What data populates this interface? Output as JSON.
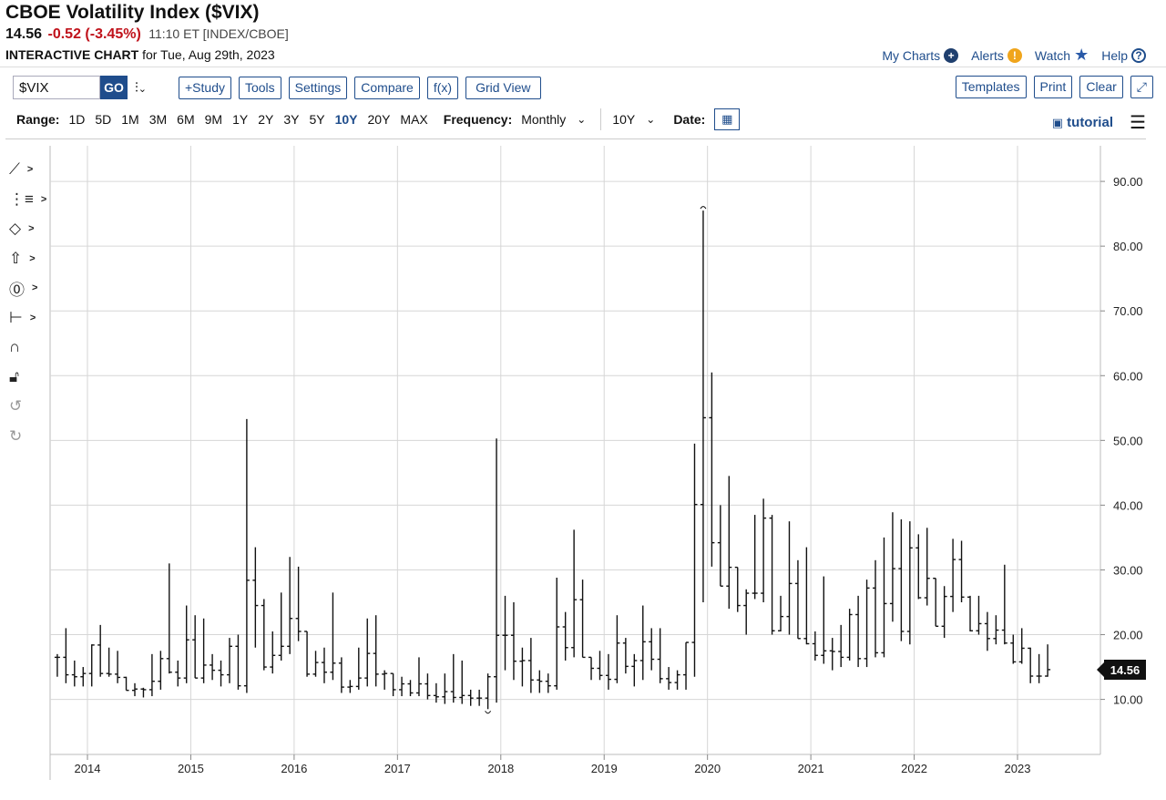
{
  "header": {
    "title": "CBOE Volatility Index ($VIX)",
    "last": "14.56",
    "change": "-0.52 (-3.45%)",
    "time": "11:10 ET [INDEX/CBOE]",
    "sub_bold": "INTERACTIVE CHART",
    "sub_rest": "for Tue, Aug 29th, 2023"
  },
  "toplinks": {
    "my_charts": "My Charts",
    "alerts": "Alerts",
    "watch": "Watch",
    "help": "Help"
  },
  "toolbar": {
    "symbol": "$VIX",
    "go": "GO",
    "study": "+Study",
    "tools": "Tools",
    "settings": "Settings",
    "compare": "Compare",
    "fx": "f(x)",
    "grid_view": "Grid View",
    "templates": "Templates",
    "print": "Print",
    "clear": "Clear"
  },
  "rangebar": {
    "range_label": "Range:",
    "ranges": [
      "1D",
      "5D",
      "1M",
      "3M",
      "6M",
      "9M",
      "1Y",
      "2Y",
      "3Y",
      "5Y",
      "10Y",
      "20Y",
      "MAX"
    ],
    "active_range": "10Y",
    "frequency_label": "Frequency:",
    "frequency": "Monthly",
    "period": "10Y",
    "date_label": "Date:",
    "tutorial": "tutorial"
  },
  "colors": {
    "accent": "#1f4d8c",
    "negative": "#c0121b",
    "bars": "#111111",
    "grid": "#d6d6d6"
  },
  "icons": [
    "line-tool-icon",
    "fib-tool-icon",
    "shape-tool-icon",
    "arrow-tool-icon",
    "text-tool-icon",
    "measure-tool-icon",
    "magnet-icon",
    "lock-icon",
    "undo-icon",
    "redo-icon"
  ],
  "chart_data": {
    "type": "ohlc",
    "frequency": "monthly",
    "x_ticks": [
      "2014",
      "2015",
      "2016",
      "2017",
      "2018",
      "2019",
      "2020",
      "2021",
      "2022",
      "2023"
    ],
    "y_ticks": [
      "10.00",
      "20.00",
      "30.00",
      "40.00",
      "50.00",
      "60.00",
      "70.00",
      "80.00",
      "90.00"
    ],
    "ylim": [
      1.5,
      95.5
    ],
    "last_value": "14.56",
    "start_month": "2013-09",
    "bars": [
      [
        16.5,
        17.0,
        13.5,
        16.5
      ],
      [
        16.5,
        21.0,
        12.5,
        13.8
      ],
      [
        13.8,
        16.0,
        12.0,
        13.5
      ],
      [
        13.5,
        15.0,
        12.0,
        14.0
      ],
      [
        14.0,
        18.5,
        12.0,
        18.4
      ],
      [
        18.4,
        21.5,
        13.5,
        14.0
      ],
      [
        14.0,
        18.0,
        13.5,
        13.9
      ],
      [
        13.9,
        17.5,
        12.5,
        13.4
      ],
      [
        13.4,
        13.5,
        11.5,
        11.4
      ],
      [
        11.4,
        12.5,
        10.5,
        11.6
      ],
      [
        11.6,
        11.8,
        10.3,
        11.5
      ],
      [
        11.5,
        17.0,
        10.5,
        12.8
      ],
      [
        12.8,
        17.5,
        11.5,
        16.3
      ],
      [
        16.3,
        31.0,
        14.0,
        14.2
      ],
      [
        14.2,
        16.0,
        12.0,
        13.3
      ],
      [
        13.3,
        24.5,
        12.5,
        19.2
      ],
      [
        19.2,
        23.0,
        16.5,
        13.3
      ],
      [
        13.3,
        22.5,
        12.5,
        15.3
      ],
      [
        15.3,
        17.0,
        13.0,
        14.5
      ],
      [
        14.5,
        16.0,
        12.0,
        13.8
      ],
      [
        13.8,
        19.5,
        12.5,
        18.2
      ],
      [
        18.2,
        20.0,
        11.5,
        12.1
      ],
      [
        12.1,
        53.3,
        11.0,
        28.4
      ],
      [
        28.4,
        33.5,
        18.0,
        24.5
      ],
      [
        24.5,
        25.5,
        14.5,
        15.0
      ],
      [
        15.0,
        20.5,
        14.0,
        16.8
      ],
      [
        16.8,
        26.5,
        16.0,
        18.2
      ],
      [
        18.2,
        32.0,
        17.0,
        22.5
      ],
      [
        22.5,
        30.5,
        19.0,
        20.5
      ],
      [
        20.5,
        20.0,
        13.5,
        13.9
      ],
      [
        13.9,
        17.5,
        13.5,
        15.7
      ],
      [
        15.7,
        18.0,
        12.5,
        14.2
      ],
      [
        14.2,
        26.5,
        13.0,
        15.6
      ],
      [
        15.6,
        16.5,
        11.0,
        11.9
      ],
      [
        11.9,
        13.0,
        11.0,
        12.0
      ],
      [
        12.0,
        18.0,
        11.5,
        13.3
      ],
      [
        13.3,
        22.5,
        12.0,
        17.1
      ],
      [
        17.1,
        23.0,
        12.0,
        13.9
      ],
      [
        13.9,
        14.5,
        11.5,
        14.0
      ],
      [
        14.0,
        13.0,
        10.5,
        11.5
      ],
      [
        11.5,
        13.5,
        10.5,
        12.4
      ],
      [
        12.4,
        13.0,
        10.5,
        11.0
      ],
      [
        11.0,
        16.5,
        10.5,
        12.4
      ],
      [
        12.4,
        14.0,
        10.0,
        10.6
      ],
      [
        10.6,
        12.5,
        9.5,
        10.4
      ],
      [
        10.4,
        14.0,
        9.3,
        11.2
      ],
      [
        11.2,
        17.0,
        9.5,
        10.3
      ],
      [
        10.3,
        16.0,
        9.3,
        10.6
      ],
      [
        10.6,
        11.5,
        9.0,
        10.2
      ],
      [
        10.2,
        11.5,
        9.0,
        10.2
      ],
      [
        10.2,
        14.0,
        8.5,
        13.5
      ],
      [
        13.5,
        50.3,
        9.5,
        19.9
      ],
      [
        19.9,
        26.0,
        14.5,
        19.9
      ],
      [
        19.9,
        25.0,
        13.0,
        15.9
      ],
      [
        15.9,
        18.0,
        12.0,
        16.0
      ],
      [
        16.0,
        19.5,
        11.0,
        13.0
      ],
      [
        13.0,
        14.5,
        11.0,
        12.8
      ],
      [
        12.8,
        14.0,
        11.0,
        12.1
      ],
      [
        12.1,
        28.8,
        11.5,
        21.2
      ],
      [
        21.2,
        23.5,
        16.0,
        18.0
      ],
      [
        18.0,
        36.2,
        16.5,
        25.4
      ],
      [
        25.4,
        28.5,
        16.5,
        16.5
      ],
      [
        16.5,
        16.5,
        13.0,
        14.8
      ],
      [
        14.8,
        17.5,
        13.0,
        13.7
      ],
      [
        13.7,
        17.0,
        11.5,
        13.1
      ],
      [
        13.1,
        23.0,
        12.5,
        18.7
      ],
      [
        18.7,
        19.5,
        14.0,
        15.1
      ],
      [
        15.1,
        17.0,
        12.0,
        16.0
      ],
      [
        16.0,
        24.5,
        13.0,
        18.9
      ],
      [
        18.9,
        21.0,
        14.5,
        16.2
      ],
      [
        16.2,
        21.0,
        12.5,
        13.2
      ],
      [
        13.2,
        15.0,
        11.5,
        12.6
      ],
      [
        12.6,
        14.5,
        11.5,
        13.8
      ],
      [
        13.8,
        18.0,
        11.5,
        18.8
      ],
      [
        18.8,
        49.5,
        13.5,
        40.1
      ],
      [
        40.1,
        85.5,
        25.0,
        53.5
      ],
      [
        53.5,
        60.5,
        30.5,
        34.2
      ],
      [
        34.2,
        40.0,
        27.5,
        27.5
      ],
      [
        27.5,
        44.5,
        24.0,
        30.4
      ],
      [
        30.4,
        30.0,
        23.5,
        24.5
      ],
      [
        24.5,
        27.0,
        20.0,
        26.4
      ],
      [
        26.4,
        38.5,
        25.5,
        26.4
      ],
      [
        26.4,
        41.0,
        25.0,
        38.0
      ],
      [
        38.0,
        38.5,
        20.0,
        20.6
      ],
      [
        20.6,
        26.0,
        20.5,
        22.8
      ],
      [
        22.8,
        37.5,
        20.0,
        27.9
      ],
      [
        27.9,
        31.5,
        19.5,
        19.4
      ],
      [
        19.4,
        33.5,
        18.5,
        18.6
      ],
      [
        18.6,
        20.5,
        16.0,
        16.8
      ],
      [
        16.8,
        29.0,
        15.5,
        17.5
      ],
      [
        17.5,
        19.5,
        14.5,
        17.4
      ],
      [
        17.4,
        21.5,
        15.0,
        16.5
      ],
      [
        16.5,
        24.0,
        16.0,
        23.1
      ],
      [
        23.1,
        26.0,
        15.0,
        16.3
      ],
      [
        16.3,
        28.5,
        15.0,
        27.2
      ],
      [
        27.2,
        31.5,
        16.5,
        17.2
      ],
      [
        17.2,
        35.0,
        16.5,
        24.8
      ],
      [
        24.8,
        38.9,
        22.0,
        30.2
      ],
      [
        30.2,
        37.8,
        19.0,
        20.5
      ],
      [
        20.5,
        37.5,
        18.5,
        33.4
      ],
      [
        33.4,
        35.5,
        25.5,
        25.7
      ],
      [
        25.7,
        36.5,
        24.5,
        28.7
      ],
      [
        28.7,
        28.5,
        22.0,
        21.3
      ],
      [
        21.3,
        27.5,
        19.5,
        25.9
      ],
      [
        25.9,
        34.8,
        23.5,
        31.6
      ],
      [
        31.6,
        34.5,
        25.0,
        25.8
      ],
      [
        25.8,
        26.0,
        20.5,
        20.6
      ],
      [
        20.6,
        26.0,
        20.0,
        21.7
      ],
      [
        21.7,
        23.5,
        17.5,
        19.4
      ],
      [
        19.4,
        23.0,
        18.5,
        20.7
      ],
      [
        20.7,
        30.8,
        18.5,
        18.7
      ],
      [
        18.7,
        20.0,
        15.5,
        15.8
      ],
      [
        15.8,
        21.0,
        15.5,
        17.9
      ],
      [
        17.9,
        18.0,
        12.5,
        13.6
      ],
      [
        13.6,
        17.0,
        12.5,
        13.6
      ],
      [
        13.6,
        18.5,
        13.5,
        14.6
      ]
    ]
  }
}
